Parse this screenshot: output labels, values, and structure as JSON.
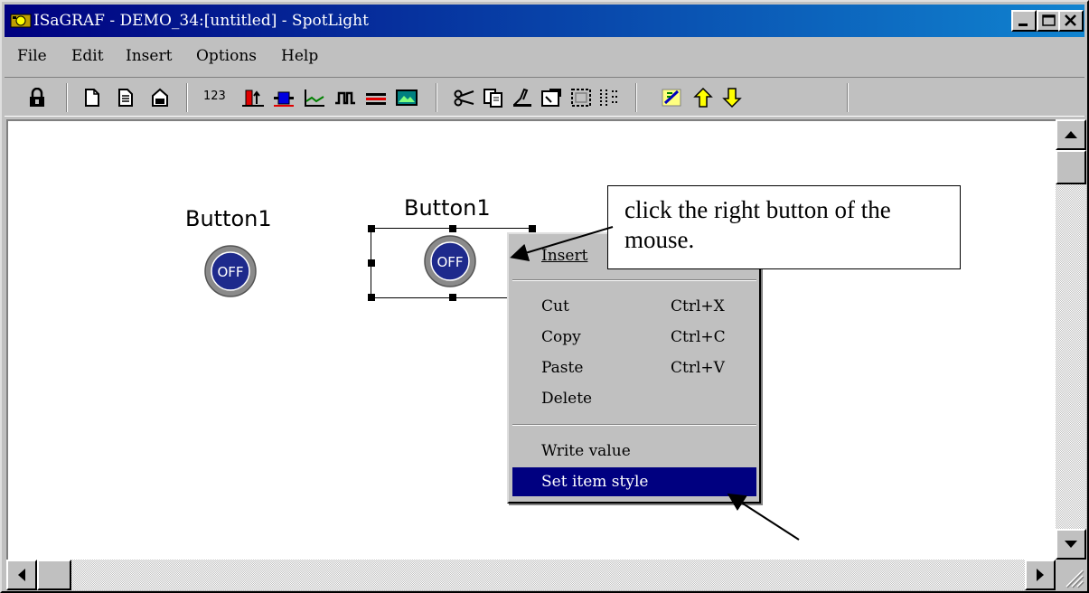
{
  "window": {
    "title": "ISaGRAF - DEMO_34:[untitled] - SpotLight",
    "controls": [
      "minimize",
      "maximize",
      "close"
    ]
  },
  "menubar": {
    "items": [
      "File",
      "Edit",
      "Insert",
      "Options",
      "Help"
    ]
  },
  "toolbar": {
    "groups": [
      [
        "lock-icon"
      ],
      [
        "new-document-icon",
        "open-document-icon",
        "save-document-icon"
      ],
      [
        "numeric-value-icon",
        "bar-graph-icon",
        "slider-icon",
        "trend-icon",
        "digital-signal-icon",
        "horizontal-bars-icon",
        "picture-icon"
      ],
      [
        "cut-icon",
        "copy-icon",
        "paste-icon",
        "properties-icon",
        "select-area-icon",
        "grid-icon"
      ],
      [
        "edit-icon",
        "bring-forward-icon",
        "send-backward-icon"
      ]
    ],
    "numeric_label": "123"
  },
  "canvas": {
    "objects": [
      {
        "label": "Button1",
        "state": "OFF"
      },
      {
        "label": "Button1",
        "state": "OFF",
        "selected": true
      }
    ]
  },
  "context_menu": {
    "items": [
      {
        "label": "Insert",
        "shortcut": ""
      },
      {
        "label": "Cut",
        "shortcut": "Ctrl+X"
      },
      {
        "label": "Copy",
        "shortcut": "Ctrl+C"
      },
      {
        "label": "Paste",
        "shortcut": "Ctrl+V"
      },
      {
        "label": "Delete",
        "shortcut": ""
      },
      {
        "label": "Write value",
        "shortcut": ""
      },
      {
        "label": "Set item style",
        "shortcut": "",
        "highlighted": true
      }
    ]
  },
  "annotation": {
    "text": "click the right button of the mouse."
  },
  "colors": {
    "title_bar": "#000080",
    "highlight": "#000080",
    "button_face": "#1e2a8c",
    "button_ring": "#8a8a8a"
  }
}
